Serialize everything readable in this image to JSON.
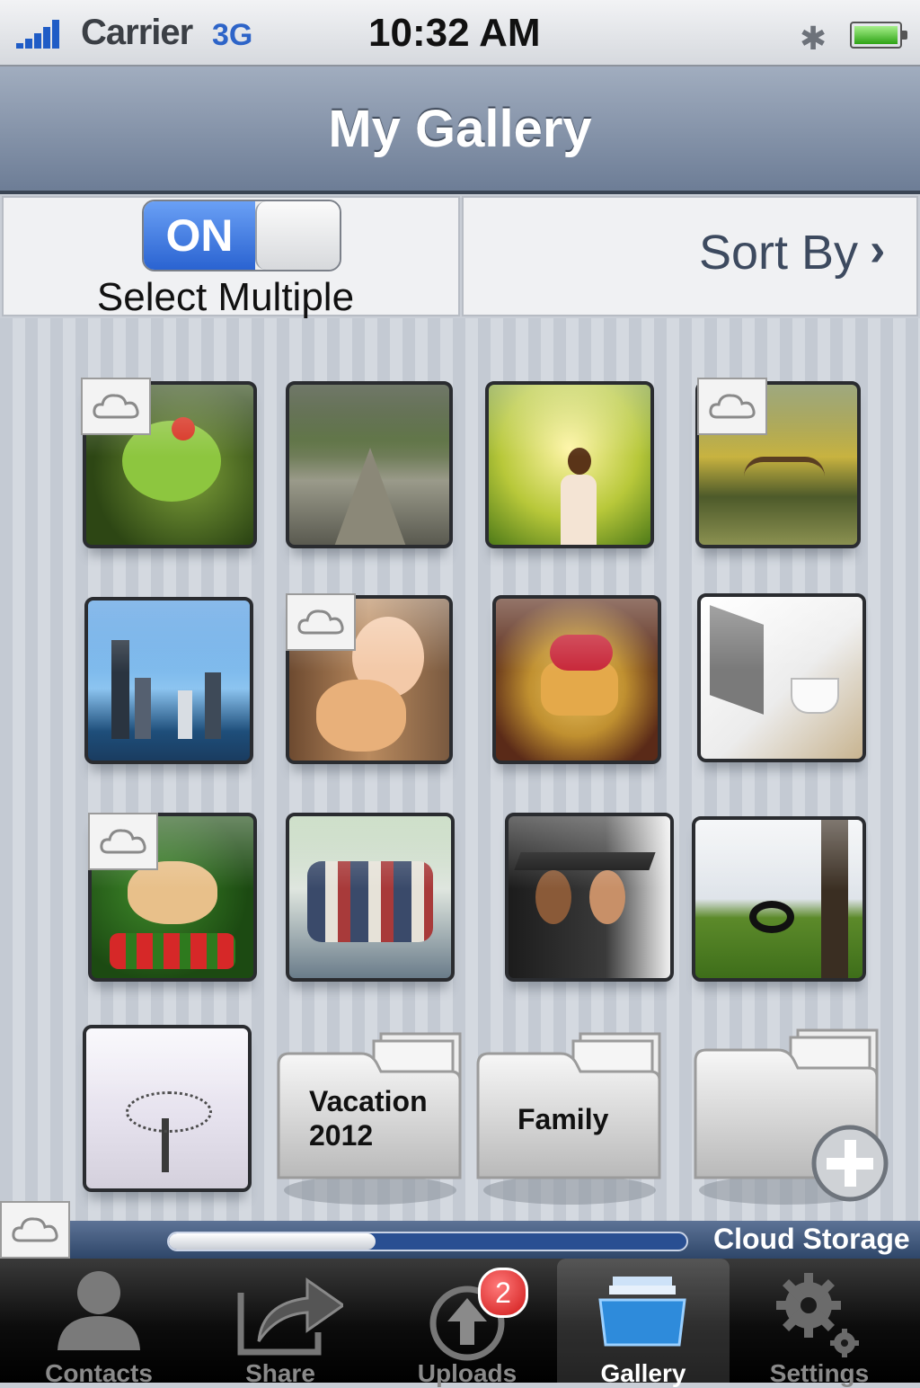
{
  "status_bar": {
    "carrier": "Carrier",
    "network": "3G",
    "time": "10:32 AM",
    "bluetooth_icon": "bluetooth-icon",
    "battery_level": 1.0
  },
  "nav": {
    "title": "My Gallery"
  },
  "controls": {
    "toggle_state": "ON",
    "select_multiple_label": "Select Multiple",
    "sort_by_label": "Sort By",
    "sort_icon": "chevron-right-icon"
  },
  "photos": [
    {
      "subject": "frog",
      "cloud": true
    },
    {
      "subject": "boardwalk",
      "cloud": false
    },
    {
      "subject": "woman-in-field",
      "cloud": false
    },
    {
      "subject": "bridge-pond",
      "cloud": true
    },
    {
      "subject": "city-skyline",
      "cloud": false
    },
    {
      "subject": "girl-with-cat",
      "cloud": true
    },
    {
      "subject": "pancakes",
      "cloud": false
    },
    {
      "subject": "laptop-coffee",
      "cloud": false
    },
    {
      "subject": "puppy-flowers",
      "cloud": true
    },
    {
      "subject": "group-friends",
      "cloud": false
    },
    {
      "subject": "graduates",
      "cloud": false
    },
    {
      "subject": "tire-swing",
      "cloud": false
    },
    {
      "subject": "winter-tree",
      "cloud": false
    }
  ],
  "folders": [
    {
      "line1": "Vacation",
      "line2": "2012"
    },
    {
      "line1": "Family",
      "line2": ""
    },
    {
      "add_icon": "plus-icon"
    }
  ],
  "cloud_storage": {
    "label": "Cloud Storage",
    "used_fraction": 0.4
  },
  "tabs": [
    {
      "label": "Contacts",
      "icon": "person-icon"
    },
    {
      "label": "Share",
      "icon": "share-arrow-icon"
    },
    {
      "label": "Uploads",
      "icon": "upload-icon",
      "badge": "2"
    },
    {
      "label": "Gallery",
      "icon": "gallery-box-icon",
      "active": true
    },
    {
      "label": "Settings",
      "icon": "gear-icon"
    }
  ],
  "colors": {
    "nav_bar": "#7a889f",
    "toggle_on": "#2a63d1",
    "badge": "#d01818"
  }
}
